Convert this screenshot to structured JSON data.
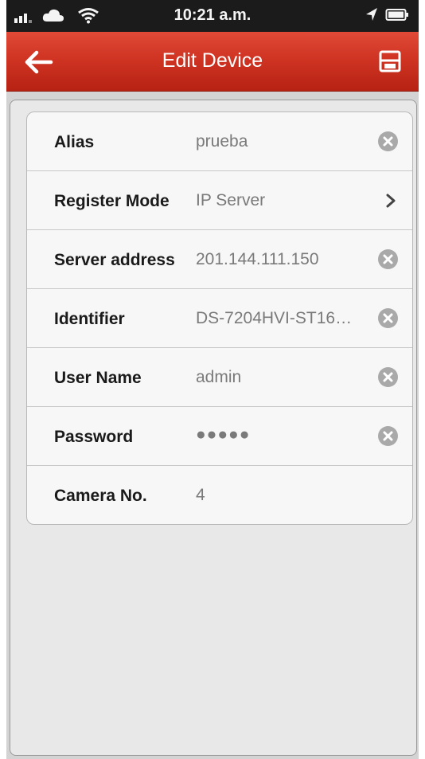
{
  "status_bar": {
    "time": "10:21 a.m.",
    "icons": [
      "signal-icon",
      "cloud-icon",
      "wifi-icon",
      "location-arrow-icon",
      "battery-icon"
    ]
  },
  "nav": {
    "title": "Edit Device",
    "back_icon": "back-arrow-icon",
    "save_icon": "save-icon",
    "color": "#d03423"
  },
  "form": {
    "rows": [
      {
        "label": "Alias",
        "value": "prueba",
        "accessory": "clear"
      },
      {
        "label": "Register Mode",
        "value": "IP Server",
        "accessory": "chevron"
      },
      {
        "label": "Server address",
        "value": "201.144.111.150",
        "accessory": "clear"
      },
      {
        "label": "Identifier",
        "value": "DS-7204HVI-ST16…",
        "accessory": "clear"
      },
      {
        "label": "User Name",
        "value": "admin",
        "accessory": "clear"
      },
      {
        "label": "Password",
        "value": "●●●●●",
        "accessory": "clear"
      },
      {
        "label": "Camera No.",
        "value": "4",
        "accessory": "none"
      }
    ]
  }
}
